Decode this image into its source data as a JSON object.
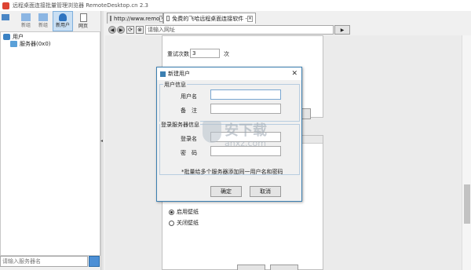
{
  "window": {
    "title": "远程桌面连接批量管理浏览器 RemoteDesktop.cn 2.3"
  },
  "toolbar": {
    "items": [
      {
        "label": "新组",
        "icon": "folder-icon"
      },
      {
        "label": "新组",
        "icon": "folder-icon"
      },
      {
        "label": "新用户",
        "icon": "user-icon"
      },
      {
        "label": "网页",
        "icon": "page-icon"
      }
    ]
  },
  "tree": {
    "root_label": "用户",
    "child_label": "服务器(0x0)"
  },
  "sidebar_search": {
    "placeholder": "请输入服务器名"
  },
  "tabs": [
    {
      "label": "http://www.remo"
    },
    {
      "label": "免费的飞哈远程桌面连接软件 -"
    }
  ],
  "address_bar": {
    "placeholder": "请输入网址"
  },
  "settings": {
    "retry_label": "重试次数",
    "retry_value": "3",
    "retry_unit": "次",
    "radio_enable": "启用壁纸",
    "radio_disable": "关闭壁纸"
  },
  "dialog": {
    "title": "新建用户",
    "group_user": "用户信息",
    "username_label": "用户名",
    "note_label": "备　注",
    "group_login": "登录服务器信息",
    "login_label": "登录名",
    "password_label": "密　码",
    "hint": "*批量给多个服务器添加同一用户名和密码",
    "ok_label": "确定",
    "cancel_label": "取消"
  },
  "watermark": {
    "text": "安下载",
    "domain": "anxz.com"
  },
  "colors": {
    "dialog_border": "#3c7fb1",
    "window_bg": "#f0f0f0",
    "title_text": "#333333"
  }
}
